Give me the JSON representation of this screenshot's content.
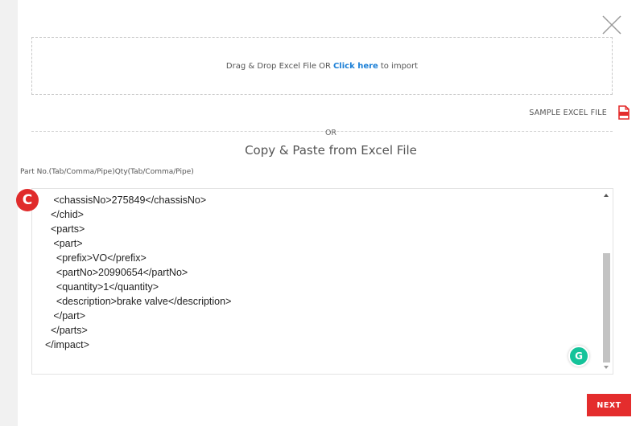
{
  "dropzone": {
    "prefix": "Drag & Drop Excel File OR",
    "link": "Click here",
    "suffix": "to import"
  },
  "sample": {
    "label": "SAMPLE EXCEL FILE",
    "icon": "excel-file-icon",
    "icon_color": "#e42d2d"
  },
  "or_text": "OR",
  "heading": "Copy & Paste from Excel File",
  "field_label": "Part No.(Tab/Comma/Pipe)Qty(Tab/Comma/Pipe)",
  "code_lines": [
    "   <chassisNo>275849</chassisNo>",
    "  </chid>",
    "  <parts>",
    "   <part>",
    "    <prefix>VO</prefix>",
    "    <partNo>20990654</partNo>",
    "    <quantity>1</quantity>",
    "    <description>brake valve</description>",
    "   </part>",
    "  </parts>",
    "</impact>"
  ],
  "overlay_badge": "C",
  "grammarly_badge": "G",
  "next_label": "NEXT",
  "colors": {
    "accent": "#e42d2d",
    "link": "#1b7fd6",
    "grammarly": "#15c39a"
  }
}
